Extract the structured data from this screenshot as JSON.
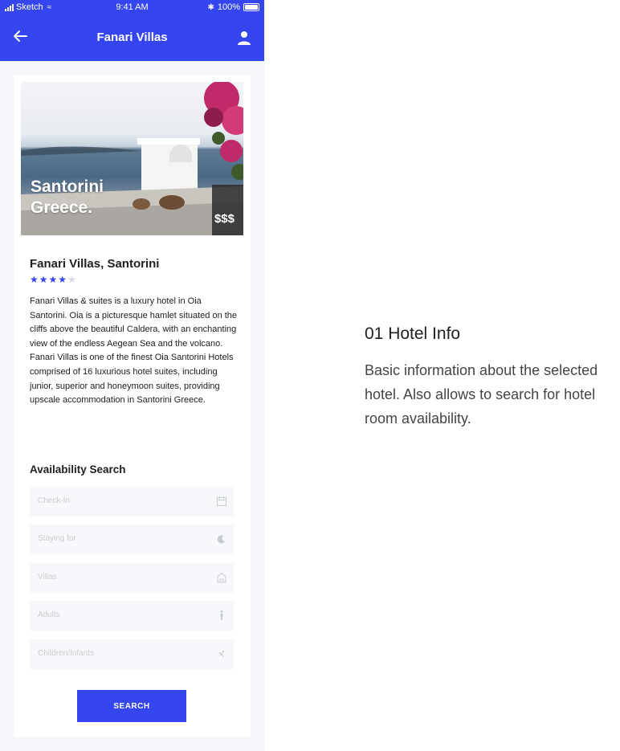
{
  "status_bar": {
    "carrier": "Sketch",
    "time": "9:41 AM",
    "battery": "100%"
  },
  "header": {
    "title": "Fanari Villas",
    "back_icon": "arrow-left-icon",
    "profile_icon": "user-icon",
    "background": "#3546f0"
  },
  "hero": {
    "headline_line1": "Santorini",
    "headline_line2": "Greece.",
    "price_tier": "$$$"
  },
  "hotel": {
    "name": "Fanari Villas, Santorini",
    "rating": 4,
    "rating_max": 5,
    "description": "Fanari Villas & suites is a luxury hotel in Oia Santorini. Oia is a picturesque hamlet situated on the cliffs above the beautiful Caldera, with an enchanting view of the endless Aegean Sea and the volcano. Fanari Villas is one of the finest Oia Santorini Hotels comprised of 16 luxurious hotel suites, including junior, superior and honeymoon suites, providing upscale accommodation in Santorini Greece."
  },
  "search": {
    "title": "Availability Search",
    "fields": [
      {
        "label": "Check-In",
        "icon": "calendar-icon"
      },
      {
        "label": "Staying for",
        "icon": "moon-icon"
      },
      {
        "label": "Villas",
        "icon": "house-icon"
      },
      {
        "label": "Adults",
        "icon": "adult-icon"
      },
      {
        "label": "Children/Infants",
        "icon": "child-icon"
      }
    ],
    "button_label": "SEARCH"
  },
  "info": {
    "title": "01 Hotel Info",
    "body": "Basic information about the selected hotel. Also allows to search for hotel room availability."
  },
  "colors": {
    "accent": "#3546f0",
    "star_inactive": "#d4d6df",
    "field_background": "#f7f8fb"
  }
}
